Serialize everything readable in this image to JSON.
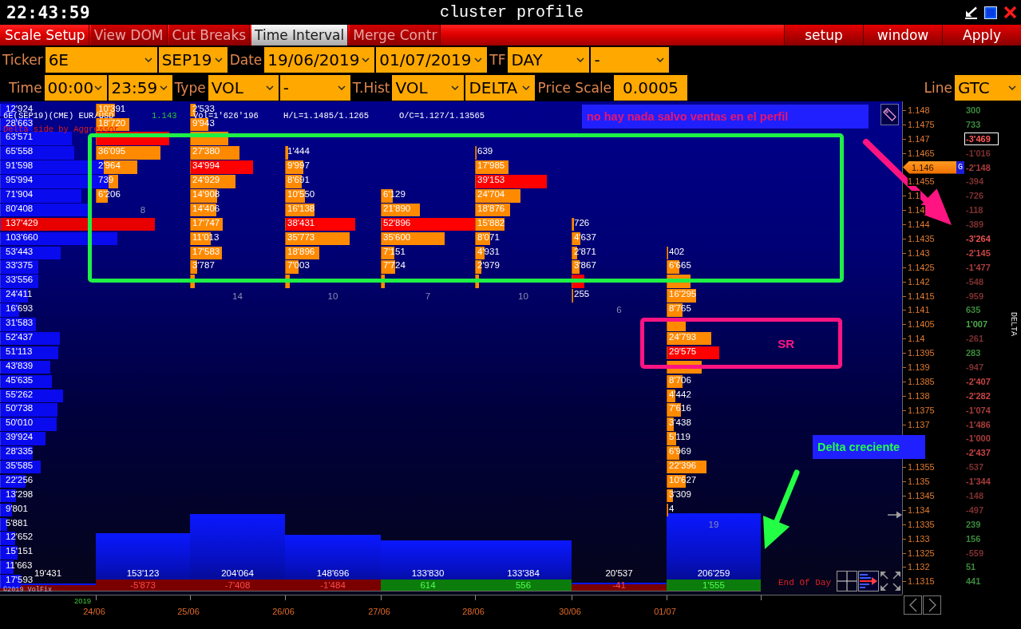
{
  "title_bar": {
    "clock": "22:43:59",
    "title": "cluster profile"
  },
  "menu": {
    "tabs": [
      {
        "label": "Scale Setup",
        "selected": false,
        "disabled": false
      },
      {
        "label": "View DOM",
        "selected": false,
        "disabled": true
      },
      {
        "label": "Cut Breaks",
        "selected": false,
        "disabled": true
      },
      {
        "label": "Time Interval",
        "selected": true,
        "disabled": false
      },
      {
        "label": "Merge Contr",
        "selected": false,
        "disabled": true
      }
    ],
    "buttons": [
      "setup",
      "window",
      "Apply"
    ]
  },
  "settings": {
    "row_1": [
      {
        "kind": "label",
        "text": "Ticker"
      },
      {
        "kind": "dropdown",
        "value": "6E"
      },
      {
        "kind": "dropdown",
        "value": "SEP19"
      },
      {
        "kind": "label",
        "text": "Date"
      },
      {
        "kind": "dropdown",
        "value": "19/06/2019"
      },
      {
        "kind": "dropdown",
        "value": "01/07/2019"
      },
      {
        "kind": "label",
        "text": "TF"
      },
      {
        "kind": "dropdown",
        "value": "DAY"
      },
      {
        "kind": "dropdown",
        "value": "-"
      }
    ],
    "row_2": [
      {
        "kind": "label",
        "text": "Time"
      },
      {
        "kind": "dropdown",
        "value": "00:00"
      },
      {
        "kind": "dropdown",
        "value": "23:59"
      },
      {
        "kind": "label",
        "text": "Type"
      },
      {
        "kind": "dropdown",
        "value": "VOL"
      },
      {
        "kind": "dropdown",
        "value": "-"
      },
      {
        "kind": "label",
        "text": "T.Hist"
      },
      {
        "kind": "dropdown",
        "value": "VOL"
      },
      {
        "kind": "dropdown",
        "value": "DELTA"
      },
      {
        "kind": "label",
        "text": "Price Scale"
      },
      {
        "kind": "field",
        "value": "0.0005"
      }
    ],
    "row_2_right": [
      {
        "kind": "label",
        "text": "Line"
      },
      {
        "kind": "dropdown",
        "value": "GTC"
      }
    ]
  },
  "chart": {
    "header": {
      "instrument": "6E(SEP19)(CME) EUR/USD",
      "last_price": "1.143",
      "volume": "Vol=1'626'196",
      "high_low": "H/L=1.1485/1.1265",
      "open_close": "O/C=1.127/1.13565",
      "delta_mode": "Delta side by Aggressor"
    },
    "rows": [
      {
        "price": "1.148",
        "current": false,
        "delta": {
          "value": "300",
          "color": "#3c8a3c",
          "highlighted": false
        },
        "profile": {
          "volume": "12'924",
          "level": 0.094,
          "max": false
        },
        "clusters": [
          {
            "kind": "bar",
            "volume": "10'391",
            "level": 0.196,
            "max": false
          },
          {
            "kind": "bar",
            "volume": "2'533",
            "level": 0.048,
            "max": false
          }
        ]
      },
      {
        "price": "1.1475",
        "current": false,
        "delta": {
          "value": "733",
          "color": "#3c8a3c",
          "highlighted": false
        },
        "profile": {
          "volume": "28'663",
          "level": 0.209,
          "max": false
        },
        "clusters": [
          {
            "kind": "bar",
            "volume": "18'720",
            "level": 0.354,
            "max": false
          },
          {
            "kind": "bar",
            "volume": "9'943",
            "level": 0.188,
            "max": false
          }
        ]
      },
      {
        "price": "1.147",
        "current": false,
        "delta": {
          "value": "-3'469",
          "color": "#ff5a5a",
          "highlighted": true
        },
        "profile": {
          "volume": "63'571",
          "level": 0.463,
          "max": false
        },
        "clusters": [
          {
            "kind": "bar",
            "level": 0.78,
            "max": true
          },
          {
            "kind": "bar",
            "level": 0.4,
            "max": false
          }
        ]
      },
      {
        "price": "1.1465",
        "current": false,
        "delta": {
          "value": "-1'016",
          "color": "#7e3030",
          "highlighted": false
        },
        "profile": {
          "volume": "65'558",
          "level": 0.477,
          "max": false
        },
        "clusters": [
          {
            "kind": "bar",
            "volume": "36'095",
            "level": 0.682,
            "max": false
          },
          {
            "kind": "bar",
            "volume": "27'380",
            "level": 0.518,
            "max": false
          },
          {
            "kind": "bar",
            "volume": "1'444",
            "level": 0.027,
            "max": false
          },
          {
            "kind": "none"
          },
          {
            "kind": "bar",
            "volume": "639",
            "level": 0.012,
            "max": false
          }
        ]
      },
      {
        "price": "1.146",
        "current": true,
        "flag": "G",
        "delta": {
          "value": "-2'148",
          "color": "#a83c3c",
          "highlighted": false
        },
        "profile": {
          "volume": "91'598",
          "level": 0.667,
          "max": false
        },
        "clusters": [
          {
            "kind": "bar",
            "volume": "2'964",
            "level": 0.44,
            "max": false
          },
          {
            "kind": "bar",
            "volume": "34'994",
            "level": 0.662,
            "max": true
          },
          {
            "kind": "bar",
            "volume": "9'997",
            "level": 0.189,
            "max": false
          },
          {
            "kind": "none"
          },
          {
            "kind": "bar",
            "volume": "17'985",
            "level": 0.34,
            "max": false
          }
        ]
      },
      {
        "price": "1.1455",
        "current": false,
        "delta": {
          "value": "-394",
          "color": "#7e3030",
          "highlighted": false
        },
        "profile": {
          "volume": "95'994",
          "level": 0.699,
          "max": false
        },
        "clusters": [
          {
            "kind": "bar",
            "volume": "739",
            "level": 0.23,
            "max": false
          },
          {
            "kind": "bar",
            "volume": "24'929",
            "level": 0.471,
            "max": false
          },
          {
            "kind": "bar",
            "volume": "8'691",
            "level": 0.164,
            "max": false
          },
          {
            "kind": "none"
          },
          {
            "kind": "bar",
            "volume": "39'153",
            "level": 0.74,
            "max": true
          }
        ]
      },
      {
        "price": "1.1",
        "current": false,
        "delta": {
          "value": "-726",
          "color": "#7e3030",
          "highlighted": false
        },
        "profile": {
          "volume": "71'904",
          "level": 0.523,
          "max": false
        },
        "clusters": [
          {
            "kind": "bar",
            "volume": "6'206",
            "level": 0.117,
            "max": false
          },
          {
            "kind": "bar",
            "volume": "14'908",
            "level": 0.282,
            "max": false
          },
          {
            "kind": "bar",
            "volume": "10'550",
            "level": 0.2,
            "max": false
          },
          {
            "kind": "bar",
            "volume": "6'129",
            "level": 0.116,
            "max": false
          },
          {
            "kind": "bar",
            "volume": "24'704",
            "level": 0.467,
            "max": false
          }
        ]
      },
      {
        "price": "1.14",
        "current": false,
        "delta": {
          "value": "-118",
          "color": "#7e3030",
          "highlighted": false
        },
        "profile": {
          "volume": "80'408",
          "level": 0.585,
          "max": false
        },
        "clusters": [
          {
            "kind": "count",
            "value": "8"
          },
          {
            "kind": "bar",
            "volume": "14'406",
            "level": 0.272,
            "max": false
          },
          {
            "kind": "bar",
            "volume": "16'138",
            "level": 0.305,
            "max": false
          },
          {
            "kind": "bar",
            "volume": "21'890",
            "level": 0.414,
            "max": false
          },
          {
            "kind": "bar",
            "volume": "18'876",
            "level": 0.357,
            "max": false
          }
        ]
      },
      {
        "price": "1.144",
        "current": false,
        "delta": {
          "value": "-389",
          "color": "#7e3030",
          "highlighted": false
        },
        "profile": {
          "volume": "137'429",
          "level": 1.0,
          "max": true
        },
        "clusters": [
          {
            "kind": "none"
          },
          {
            "kind": "bar",
            "volume": "17'747",
            "level": 0.336,
            "max": false
          },
          {
            "kind": "bar",
            "volume": "38'431",
            "level": 0.727,
            "max": true
          },
          {
            "kind": "bar",
            "volume": "52'896",
            "level": 1.0,
            "max": true
          },
          {
            "kind": "bar",
            "volume": "15'882",
            "level": 0.3,
            "max": false
          },
          {
            "kind": "bar",
            "volume": "726",
            "level": 0.014,
            "max": false
          }
        ]
      },
      {
        "price": "1.1435",
        "current": false,
        "delta": {
          "value": "-3'264",
          "color": "#e85050",
          "highlighted": false
        },
        "profile": {
          "volume": "103'660",
          "level": 0.754,
          "max": false
        },
        "clusters": [
          {
            "kind": "none"
          },
          {
            "kind": "bar",
            "volume": "11'013",
            "level": 0.208,
            "max": false
          },
          {
            "kind": "bar",
            "volume": "35'773",
            "level": 0.676,
            "max": false
          },
          {
            "kind": "bar",
            "volume": "35'600",
            "level": 0.673,
            "max": false
          },
          {
            "kind": "bar",
            "volume": "8'071",
            "level": 0.153,
            "max": false
          },
          {
            "kind": "bar",
            "volume": "4'637",
            "level": 0.088,
            "max": false
          }
        ]
      },
      {
        "price": "1.143",
        "current": false,
        "delta": {
          "value": "-2'145",
          "color": "#c84444",
          "highlighted": false
        },
        "profile": {
          "volume": "53'443",
          "level": 0.389,
          "max": false
        },
        "clusters": [
          {
            "kind": "none"
          },
          {
            "kind": "bar",
            "volume": "17'583",
            "level": 0.332,
            "max": false
          },
          {
            "kind": "bar",
            "volume": "18'896",
            "level": 0.357,
            "max": false
          },
          {
            "kind": "bar",
            "volume": "7'151",
            "level": 0.135,
            "max": false
          },
          {
            "kind": "bar",
            "volume": "4'931",
            "level": 0.093,
            "max": false
          },
          {
            "kind": "bar",
            "volume": "2'871",
            "level": 0.054,
            "max": false
          },
          {
            "kind": "bar",
            "volume": "402",
            "level": 0.008,
            "max": false
          }
        ]
      },
      {
        "price": "1.1425",
        "current": false,
        "delta": {
          "value": "-1'477",
          "color": "#a83c3c",
          "highlighted": false
        },
        "profile": {
          "volume": "33'375",
          "level": 0.243,
          "max": false
        },
        "clusters": [
          {
            "kind": "none"
          },
          {
            "kind": "bar",
            "volume": "3'787",
            "level": 0.072,
            "max": false
          },
          {
            "kind": "bar",
            "volume": "7'003",
            "level": 0.132,
            "max": false
          },
          {
            "kind": "bar",
            "volume": "7'724",
            "level": 0.146,
            "max": false
          },
          {
            "kind": "bar",
            "volume": "2'979",
            "level": 0.056,
            "max": false
          },
          {
            "kind": "bar",
            "volume": "3'867",
            "level": 0.073,
            "max": false
          },
          {
            "kind": "bar",
            "volume": "6'665",
            "level": 0.126,
            "max": false
          }
        ]
      },
      {
        "price": "1.142",
        "current": false,
        "delta": {
          "value": "-548",
          "color": "#7e3030",
          "highlighted": false
        },
        "profile": {
          "volume": "33'556",
          "level": 0.244,
          "max": false
        },
        "clusters": [
          {
            "kind": "none"
          },
          {
            "kind": "bar",
            "level": 0.04,
            "max": false
          },
          {
            "kind": "bar",
            "level": 0.04,
            "max": false
          },
          {
            "kind": "bar",
            "level": 0.03,
            "max": false
          },
          {
            "kind": "bar",
            "level": 0.03,
            "max": false
          },
          {
            "kind": "bar",
            "level": 0.13,
            "max": true
          },
          {
            "kind": "bar",
            "level": 0.25,
            "max": false
          }
        ]
      },
      {
        "price": "1.1415",
        "current": false,
        "delta": {
          "value": "-959",
          "color": "#7e3030",
          "highlighted": false
        },
        "profile": {
          "volume": "24'411",
          "level": 0.178,
          "max": false
        },
        "clusters": [
          {
            "kind": "none"
          },
          {
            "kind": "count",
            "value": "14"
          },
          {
            "kind": "count",
            "value": "10"
          },
          {
            "kind": "count",
            "value": "7"
          },
          {
            "kind": "count",
            "value": "10"
          },
          {
            "kind": "bar",
            "volume": "255",
            "level": 0.005,
            "max": false
          },
          {
            "kind": "bar",
            "volume": "16'295",
            "level": 0.308,
            "max": false
          }
        ]
      },
      {
        "price": "1.141",
        "current": false,
        "delta": {
          "value": "635",
          "color": "#3c8a3c",
          "highlighted": false
        },
        "profile": {
          "volume": "16'693",
          "level": 0.121,
          "max": false
        },
        "clusters": [
          {
            "kind": "none"
          },
          {
            "kind": "none"
          },
          {
            "kind": "none"
          },
          {
            "kind": "none"
          },
          {
            "kind": "none"
          },
          {
            "kind": "count",
            "value": "6"
          },
          {
            "kind": "bar",
            "volume": "8'765",
            "level": 0.166,
            "max": false
          }
        ]
      },
      {
        "price": "1.1405",
        "current": false,
        "delta": {
          "value": "1'007",
          "color": "#4ea84e",
          "highlighted": false
        },
        "profile": {
          "volume": "31'583",
          "level": 0.23,
          "max": false
        },
        "clusters": [
          {
            "kind": "none"
          },
          {
            "kind": "none"
          },
          {
            "kind": "none"
          },
          {
            "kind": "none"
          },
          {
            "kind": "none"
          },
          {
            "kind": "none"
          },
          {
            "kind": "bar",
            "level": 0.2,
            "max": false
          }
        ]
      },
      {
        "price": "1.14",
        "current": false,
        "delta": {
          "value": "-261",
          "color": "#7e3030",
          "highlighted": false
        },
        "profile": {
          "volume": "52'437",
          "level": 0.382,
          "max": false
        },
        "clusters": [
          {
            "kind": "none"
          },
          {
            "kind": "none"
          },
          {
            "kind": "none"
          },
          {
            "kind": "none"
          },
          {
            "kind": "none"
          },
          {
            "kind": "none"
          },
          {
            "kind": "bar",
            "volume": "24'793",
            "level": 0.469,
            "max": false
          }
        ]
      },
      {
        "price": "1.1395",
        "current": false,
        "delta": {
          "value": "283",
          "color": "#3c8a3c",
          "highlighted": false
        },
        "profile": {
          "volume": "51'113",
          "level": 0.372,
          "max": false
        },
        "clusters": [
          {
            "kind": "none"
          },
          {
            "kind": "none"
          },
          {
            "kind": "none"
          },
          {
            "kind": "none"
          },
          {
            "kind": "none"
          },
          {
            "kind": "none"
          },
          {
            "kind": "bar",
            "volume": "29'575",
            "level": 0.559,
            "max": true
          }
        ]
      },
      {
        "price": "1.139",
        "current": false,
        "delta": {
          "value": "-947",
          "color": "#7e3030",
          "highlighted": false
        },
        "profile": {
          "volume": "43'839",
          "level": 0.319,
          "max": false
        },
        "clusters": [
          {
            "kind": "none"
          },
          {
            "kind": "none"
          },
          {
            "kind": "none"
          },
          {
            "kind": "none"
          },
          {
            "kind": "none"
          },
          {
            "kind": "none"
          },
          {
            "kind": "bar",
            "level": 0.37,
            "max": false
          }
        ]
      },
      {
        "price": "1.1385",
        "current": false,
        "delta": {
          "value": "-2'407",
          "color": "#c84444",
          "highlighted": false
        },
        "profile": {
          "volume": "45'635",
          "level": 0.332,
          "max": false
        },
        "clusters": [
          {
            "kind": "none"
          },
          {
            "kind": "none"
          },
          {
            "kind": "none"
          },
          {
            "kind": "none"
          },
          {
            "kind": "none"
          },
          {
            "kind": "none"
          },
          {
            "kind": "bar",
            "volume": "8'706",
            "level": 0.165,
            "max": false
          }
        ]
      },
      {
        "price": "1.138",
        "current": false,
        "delta": {
          "value": "-2'282",
          "color": "#c84444",
          "highlighted": false
        },
        "profile": {
          "volume": "55'262",
          "level": 0.402,
          "max": false
        },
        "clusters": [
          {
            "kind": "none"
          },
          {
            "kind": "none"
          },
          {
            "kind": "none"
          },
          {
            "kind": "none"
          },
          {
            "kind": "none"
          },
          {
            "kind": "none"
          },
          {
            "kind": "bar",
            "volume": "4'442",
            "level": 0.084,
            "max": false
          }
        ]
      },
      {
        "price": "1.1375",
        "current": false,
        "delta": {
          "value": "-1'074",
          "color": "#a83c3c",
          "highlighted": false
        },
        "profile": {
          "volume": "50'738",
          "level": 0.369,
          "max": false
        },
        "clusters": [
          {
            "kind": "none"
          },
          {
            "kind": "none"
          },
          {
            "kind": "none"
          },
          {
            "kind": "none"
          },
          {
            "kind": "none"
          },
          {
            "kind": "none"
          },
          {
            "kind": "bar",
            "volume": "7'616",
            "level": 0.144,
            "max": false
          }
        ]
      },
      {
        "price": "1.137",
        "current": false,
        "delta": {
          "value": "-1'486",
          "color": "#a83c3c",
          "highlighted": false
        },
        "profile": {
          "volume": "50'010",
          "level": 0.364,
          "max": false
        },
        "clusters": [
          {
            "kind": "none"
          },
          {
            "kind": "none"
          },
          {
            "kind": "none"
          },
          {
            "kind": "none"
          },
          {
            "kind": "none"
          },
          {
            "kind": "none"
          },
          {
            "kind": "bar",
            "volume": "3'438",
            "level": 0.065,
            "max": false
          }
        ]
      },
      {
        "delta": {
          "value": "-1'000",
          "color": "#a83c3c",
          "highlighted": false
        },
        "profile": {
          "volume": "39'924",
          "level": 0.29,
          "max": false
        },
        "clusters": [
          {
            "kind": "none"
          },
          {
            "kind": "none"
          },
          {
            "kind": "none"
          },
          {
            "kind": "none"
          },
          {
            "kind": "none"
          },
          {
            "kind": "none"
          },
          {
            "kind": "bar",
            "volume": "5'119",
            "level": 0.097,
            "max": false
          }
        ]
      },
      {
        "delta": {
          "value": "-2'437",
          "color": "#c84444",
          "highlighted": false
        },
        "profile": {
          "volume": "28'335",
          "level": 0.206,
          "max": false
        },
        "clusters": [
          {
            "kind": "none"
          },
          {
            "kind": "none"
          },
          {
            "kind": "none"
          },
          {
            "kind": "none"
          },
          {
            "kind": "none"
          },
          {
            "kind": "none"
          },
          {
            "kind": "bar",
            "volume": "6'969",
            "level": 0.132,
            "max": false
          }
        ]
      },
      {
        "price": "1.1355",
        "current": false,
        "delta": {
          "value": "-537",
          "color": "#7e3030",
          "highlighted": false
        },
        "profile": {
          "volume": "35'585",
          "level": 0.259,
          "max": false
        },
        "clusters": [
          {
            "kind": "none"
          },
          {
            "kind": "none"
          },
          {
            "kind": "none"
          },
          {
            "kind": "none"
          },
          {
            "kind": "none"
          },
          {
            "kind": "none"
          },
          {
            "kind": "bar",
            "volume": "22'396",
            "level": 0.423,
            "max": false
          }
        ]
      },
      {
        "price": "1.135",
        "current": false,
        "delta": {
          "value": "-1'344",
          "color": "#a83c3c",
          "highlighted": false
        },
        "profile": {
          "volume": "22'256",
          "level": 0.162,
          "max": false
        },
        "clusters": [
          {
            "kind": "none"
          },
          {
            "kind": "none"
          },
          {
            "kind": "none"
          },
          {
            "kind": "none"
          },
          {
            "kind": "none"
          },
          {
            "kind": "none"
          },
          {
            "kind": "bar",
            "volume": "10'627",
            "level": 0.2,
            "max": false
          }
        ]
      },
      {
        "price": "1.1345",
        "current": false,
        "delta": {
          "value": "-148",
          "color": "#7e3030",
          "highlighted": false
        },
        "profile": {
          "volume": "13'298",
          "level": 0.097,
          "max": false
        },
        "clusters": [
          {
            "kind": "none"
          },
          {
            "kind": "none"
          },
          {
            "kind": "none"
          },
          {
            "kind": "none"
          },
          {
            "kind": "none"
          },
          {
            "kind": "none"
          },
          {
            "kind": "bar",
            "volume": "3'309",
            "level": 0.063,
            "max": false
          }
        ]
      },
      {
        "price": "1.134",
        "current": false,
        "delta": {
          "value": "-497",
          "color": "#7e3030",
          "highlighted": false
        },
        "profile": {
          "volume": "9'801",
          "level": 0.071,
          "max": false
        },
        "clusters": [
          {
            "kind": "none"
          },
          {
            "kind": "none"
          },
          {
            "kind": "none"
          },
          {
            "kind": "none"
          },
          {
            "kind": "none"
          },
          {
            "kind": "none"
          },
          {
            "kind": "bar",
            "volume": "4",
            "level": 0.0,
            "max": false
          }
        ]
      },
      {
        "price": "1.1335",
        "current": false,
        "delta": {
          "value": "239",
          "color": "#3c8a3c",
          "highlighted": false
        },
        "profile": {
          "volume": "5'881",
          "level": 0.043,
          "max": false
        },
        "clusters": [
          {
            "kind": "none"
          },
          {
            "kind": "none"
          },
          {
            "kind": "none"
          },
          {
            "kind": "none"
          },
          {
            "kind": "none"
          },
          {
            "kind": "none"
          },
          {
            "kind": "count",
            "value": "19"
          }
        ]
      },
      {
        "price": "1.133",
        "current": false,
        "delta": {
          "value": "156",
          "color": "#3c8a3c",
          "highlighted": false
        },
        "profile": {
          "volume": "12'652",
          "level": 0.092,
          "max": false
        }
      },
      {
        "price": "1.1325",
        "current": false,
        "delta": {
          "value": "-559",
          "color": "#7e3030",
          "highlighted": false
        },
        "profile": {
          "volume": "15'151",
          "level": 0.11,
          "max": false
        }
      },
      {
        "price": "1.132",
        "current": false,
        "delta": {
          "value": "51",
          "color": "#3c8a3c",
          "highlighted": false
        },
        "profile": {
          "volume": "11'663",
          "level": 0.085,
          "max": false
        }
      },
      {
        "price": "1.1315",
        "current": false,
        "delta": {
          "value": "441",
          "color": "#3c8a3c",
          "highlighted": false
        },
        "profile": {
          "volume": "17'593",
          "level": 0.128,
          "max": false
        }
      }
    ],
    "histogram": [
      {
        "volume": "19'431",
        "kind": "sell"
      },
      {
        "volume": "153'123",
        "delta": "-5'873",
        "kind": "sell"
      },
      {
        "volume": "204'064",
        "delta": "-7'408",
        "kind": "sell"
      },
      {
        "volume": "148'696",
        "delta": "-1'484",
        "kind": "sell"
      },
      {
        "volume": "133'830",
        "delta": "614",
        "kind": "buy"
      },
      {
        "volume": "133'384",
        "delta": "556",
        "kind": "buy"
      },
      {
        "volume": "20'537",
        "delta": "-41",
        "kind": "sell"
      },
      {
        "volume": "206'259",
        "delta": "1'555",
        "kind": "buy"
      }
    ],
    "end_of_day": "End Of Day",
    "copyright": "©2019 VolFix"
  },
  "price_axis": {
    "title": "DELTA"
  },
  "date_axis": {
    "year": "2019",
    "dates": [
      "24/06",
      "25/06",
      "26/06",
      "27/06",
      "28/06",
      "30/06",
      "01/07"
    ]
  },
  "annotations": [
    {
      "kind": "note",
      "text": "no hay nada salvo ventas en el perfil",
      "color": "#e8146e"
    },
    {
      "kind": "frame",
      "color": "#1ff046"
    },
    {
      "kind": "frame",
      "color": "#ff1482",
      "label": "SR"
    },
    {
      "kind": "arrow",
      "color": "#ff1482"
    },
    {
      "kind": "note",
      "text": "Delta creciente",
      "color": "#22ff44"
    },
    {
      "kind": "arrow",
      "color": "#22ff44"
    }
  ]
}
